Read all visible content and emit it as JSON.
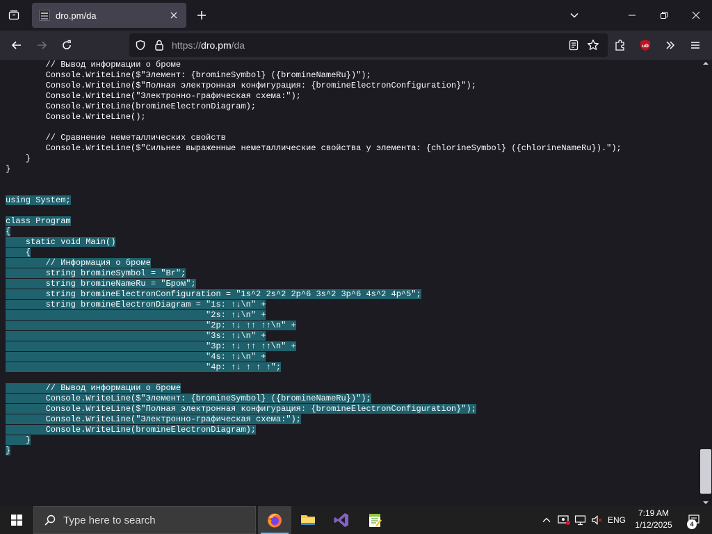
{
  "browser": {
    "tab": {
      "title": "dro.pm/da"
    },
    "url": {
      "protocol": "https://",
      "host": "dro.pm",
      "path": "/da"
    },
    "toolbar_icons": [
      "back-icon",
      "forward-icon",
      "reload-icon",
      "shield-icon",
      "lock-icon",
      "reader-view-icon",
      "bookmark-star-icon",
      "extensions-icon",
      "ublock-icon",
      "overflow-menu-icon",
      "hamburger-menu-icon"
    ],
    "colors": {
      "chrome": "#1c1b22",
      "toolbar": "#2b2a33",
      "tab_active": "#42414d",
      "selection": "#1f616c",
      "ublock": "#c1121f"
    }
  },
  "code": {
    "lines": [
      {
        "plain": "        // Вывод информации о броме",
        "sel": ""
      },
      {
        "plain": "        Console.WriteLine($\"Элемент: {bromineSymbol} ({bromineNameRu})\");",
        "sel": ""
      },
      {
        "plain": "        Console.WriteLine($\"Полная электронная конфигурация: {bromineElectronConfiguration}\");",
        "sel": ""
      },
      {
        "plain": "        Console.WriteLine(\"Электронно-графическая схема:\");",
        "sel": ""
      },
      {
        "plain": "        Console.WriteLine(bromineElectronDiagram);",
        "sel": ""
      },
      {
        "plain": "        Console.WriteLine();",
        "sel": ""
      },
      {
        "plain": "",
        "sel": ""
      },
      {
        "plain": "        // Сравнение неметаллических свойств",
        "sel": ""
      },
      {
        "plain": "        Console.WriteLine($\"Сильнее выраженные неметаллические свойства у элемента: {chlorineSymbol} ({chlorineNameRu}).\");",
        "sel": ""
      },
      {
        "plain": "    }",
        "sel": ""
      },
      {
        "plain": "}",
        "sel": ""
      },
      {
        "plain": "",
        "sel": ""
      },
      {
        "plain": "",
        "sel": ""
      },
      {
        "plain": "",
        "sel": "using System;"
      },
      {
        "plain": "",
        "sel": ""
      },
      {
        "plain": "",
        "sel": "class Program"
      },
      {
        "plain": "",
        "sel": "{"
      },
      {
        "plain": "",
        "sel": "    static void Main()"
      },
      {
        "plain": "",
        "sel": "    {"
      },
      {
        "plain": "",
        "sel": "        // Информация о броме"
      },
      {
        "plain": "",
        "sel": "        string bromineSymbol = \"Br\";"
      },
      {
        "plain": "",
        "sel": "        string bromineNameRu = \"Бром\";"
      },
      {
        "plain": "",
        "sel": "        string bromineElectronConfiguration = \"1s^2 2s^2 2p^6 3s^2 3p^6 4s^2 4p^5\";"
      },
      {
        "plain": "",
        "sel": "        string bromineElectronDiagram = \"1s: ↑↓\\n\" +"
      },
      {
        "plain": "",
        "sel": "                                        \"2s: ↑↓\\n\" +"
      },
      {
        "plain": "",
        "sel": "                                        \"2p: ↑↓ ↑↑ ↑↑\\n\" +"
      },
      {
        "plain": "",
        "sel": "                                        \"3s: ↑↓\\n\" +"
      },
      {
        "plain": "",
        "sel": "                                        \"3p: ↑↓ ↑↑ ↑↑\\n\" +"
      },
      {
        "plain": "",
        "sel": "                                        \"4s: ↑↓\\n\" +"
      },
      {
        "plain": "",
        "sel": "                                        \"4p: ↑↓ ↑ ↑ ↑\";"
      },
      {
        "plain": "",
        "sel": ""
      },
      {
        "plain": "",
        "sel": "        // Вывод информации о броме"
      },
      {
        "plain": "",
        "sel": "        Console.WriteLine($\"Элемент: {bromineSymbol} ({bromineNameRu})\");"
      },
      {
        "plain": "",
        "sel": "        Console.WriteLine($\"Полная электронная конфигурация: {bromineElectronConfiguration}\");"
      },
      {
        "plain": "",
        "sel": "        Console.WriteLine(\"Электронно-графическая схема:\");"
      },
      {
        "plain": "",
        "sel": "        Console.WriteLine(bromineElectronDiagram);"
      },
      {
        "plain": "",
        "sel": "    }"
      },
      {
        "plain": "",
        "sel": "}"
      }
    ]
  },
  "taskbar": {
    "search_placeholder": "Type here to search",
    "apps": [
      "firefox-icon",
      "file-explorer-icon",
      "visual-studio-icon",
      "notepad-plus-plus-icon"
    ],
    "tray": {
      "language": "ENG",
      "time": "7:19 AM",
      "date": "1/12/2025",
      "notification_count": "4"
    },
    "colors": {
      "background": "#1f1f1f",
      "search": "#3a3a3a",
      "accent": "#76b9ed"
    }
  }
}
